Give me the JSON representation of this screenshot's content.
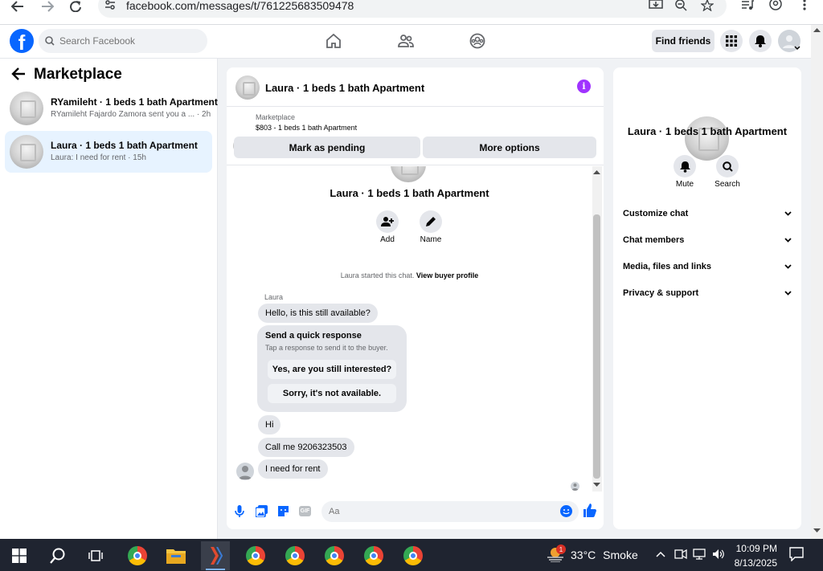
{
  "browser": {
    "url": "facebook.com/messages/t/761225683509478"
  },
  "topbar": {
    "search_placeholder": "Search Facebook",
    "find_friends": "Find friends"
  },
  "marketplace": {
    "title": "Marketplace",
    "conversations": [
      {
        "title": "RYamileht · 1 beds 1 bath Apartment",
        "snippet": "RYamileht Fajardo Zamora sent you a ... · 2h"
      },
      {
        "title": "Laura · 1 beds 1 bath Apartment",
        "snippet": "Laura: I need for rent · 15h"
      }
    ]
  },
  "chat": {
    "header_name": "Laura · 1 beds 1 bath Apartment",
    "listing_label": "Marketplace",
    "listing_price": "$803 - 1 beds 1 bath Apartment",
    "mark_pending": "Mark as pending",
    "more_options": "More options",
    "title": "Laura · 1 beds 1 bath Apartment",
    "add_label": "Add",
    "name_label": "Name",
    "started_text": "Laura started this chat.",
    "view_buyer": "View buyer profile",
    "sender": "Laura",
    "messages": [
      "Hello, is this still available?",
      "Hi",
      "Call me 9206323503",
      "I need for rent"
    ],
    "quick_response_title": "Send a quick response",
    "quick_response_sub": "Tap a response to send it to the buyer.",
    "quick_replies": [
      "Yes, are you still interested?",
      "Sorry, it's not available."
    ],
    "composer_placeholder": "Aa"
  },
  "info_panel": {
    "title": "Laura · 1 beds 1 bath Apartment",
    "mute": "Mute",
    "search": "Search",
    "sections": [
      "Customize chat",
      "Chat members",
      "Media, files and links",
      "Privacy & support"
    ]
  },
  "taskbar": {
    "temperature": "33°C",
    "weather": "Smoke",
    "time": "10:09 PM",
    "date": "8/13/2025",
    "weather_badge": "1"
  },
  "colors": {
    "fb_blue": "#0866ff",
    "active_conv_bg": "#e7f3ff",
    "info_purple": "#a033ff",
    "taskbar_bg": "#1f2430"
  }
}
